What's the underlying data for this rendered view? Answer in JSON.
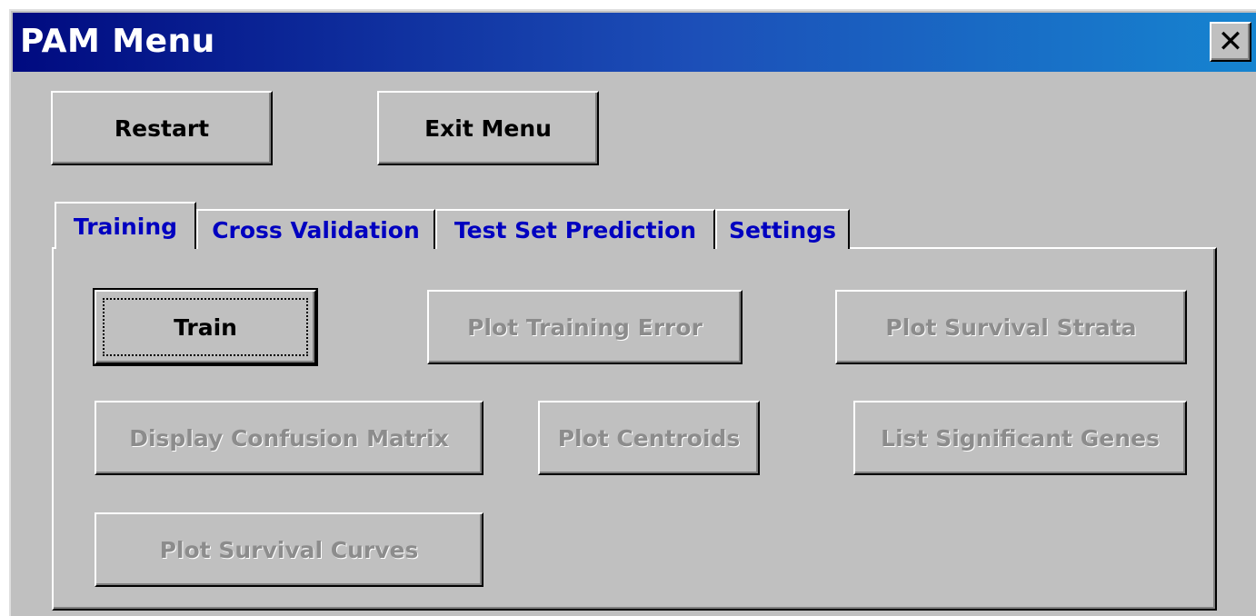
{
  "window": {
    "title": "PAM Menu",
    "close_glyph": "✕"
  },
  "toolbar": {
    "restart_label": "Restart",
    "exit_label": "Exit Menu"
  },
  "tabs": [
    {
      "label": "Training",
      "active": true
    },
    {
      "label": "Cross Validation",
      "active": false
    },
    {
      "label": "Test Set Prediction",
      "active": false
    },
    {
      "label": "Settings",
      "active": false
    }
  ],
  "training_panel": {
    "train": {
      "label": "Train",
      "enabled": true
    },
    "plot_training_error": {
      "label": "Plot Training Error",
      "enabled": false
    },
    "plot_survival_strata": {
      "label": "Plot Survival Strata",
      "enabled": false
    },
    "display_confusion_matrix": {
      "label": "Display Confusion Matrix",
      "enabled": false
    },
    "plot_centroids": {
      "label": "Plot Centroids",
      "enabled": false
    },
    "list_significant_genes": {
      "label": "List Significant Genes",
      "enabled": false
    },
    "plot_survival_curves": {
      "label": "Plot Survival Curves",
      "enabled": false
    }
  },
  "colors": {
    "title_gradient_start": "#000a80",
    "title_gradient_end": "#1684d0",
    "face": "#c0c0c0",
    "tab_text": "#0000c0",
    "disabled_text": "#8c8c8c"
  }
}
